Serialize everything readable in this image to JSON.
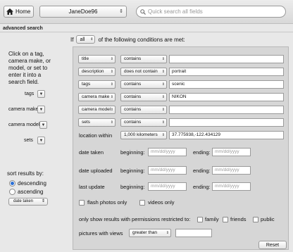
{
  "toolbar": {
    "home_label": "Home",
    "user": "JaneDoe96",
    "search_placeholder": "Quick search all fields"
  },
  "section_label": "advanced search",
  "left": {
    "help": "Click on a tag, camera make, or model, or set to enter it into a search field.",
    "labels": [
      "tags",
      "camera make",
      "camera model",
      "sets"
    ],
    "sort_label": "sort results by:",
    "radios": [
      "descending",
      "ascending"
    ],
    "sort_value": "date taken"
  },
  "match": {
    "prefix": "If",
    "value": "all",
    "suffix": "of the following conditions are met:"
  },
  "conditions": [
    {
      "field": "title",
      "op": "contains",
      "value": ""
    },
    {
      "field": "description",
      "op": "does not contain",
      "value": "portrait"
    },
    {
      "field": "tags",
      "op": "contains",
      "value": "scenic"
    },
    {
      "field": "camera make",
      "op": "contains",
      "value": "NIKON"
    },
    {
      "field": "camera model",
      "op": "contains",
      "value": ""
    },
    {
      "field": "sets",
      "op": "contains",
      "value": ""
    }
  ],
  "location": {
    "label": "location within",
    "distance": "1,000 kilometers",
    "coords": "37.775938,-122.434129"
  },
  "dates": [
    {
      "label": "date taken",
      "begin": "beginning:",
      "end": "ending:",
      "placeholder": "mm/dd/yyyy"
    },
    {
      "label": "date uploaded",
      "begin": "beginning:",
      "end": "ending:",
      "placeholder": "mm/dd/yyyy"
    },
    {
      "label": "last update",
      "begin": "beginning:",
      "end": "ending:",
      "placeholder": "mm/dd/yyyy"
    }
  ],
  "media": {
    "flash": "flash photos only",
    "videos": "videos only"
  },
  "permissions": {
    "label": "only show results with permissions restricted to:",
    "family": "family",
    "friends": "friends",
    "public": "public"
  },
  "views": {
    "label": "pictures with views",
    "op": "greater than",
    "value": ""
  },
  "reset_label": "Reset"
}
